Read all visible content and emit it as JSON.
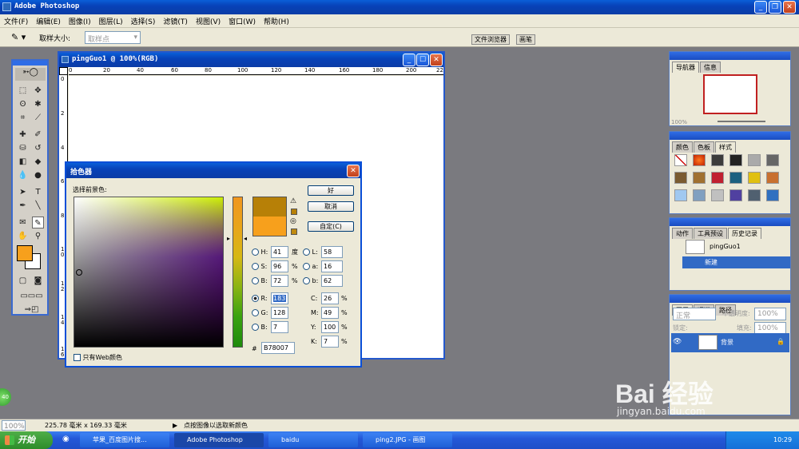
{
  "app": {
    "title": "Adobe Photoshop"
  },
  "menu": [
    "文件(F)",
    "编辑(E)",
    "图像(I)",
    "图层(L)",
    "选择(S)",
    "滤镜(T)",
    "视图(V)",
    "窗口(W)",
    "帮助(H)"
  ],
  "options": {
    "sample_size_label": "取样大小:",
    "sample_value": "取样点",
    "tab_file_browser": "文件浏览器",
    "tab_brushes": "画笔"
  },
  "doc": {
    "title": "pingGuo1 @ 100%(RGB)",
    "ruler": [
      "0",
      "20",
      "40",
      "60",
      "80",
      "100",
      "120",
      "140",
      "160",
      "180",
      "200",
      "22"
    ],
    "ruler_v": [
      "0",
      "2",
      "4",
      "6",
      "8",
      "1 0",
      "1 2",
      "1 4",
      "1 6"
    ]
  },
  "picker": {
    "title": "拾色器",
    "label": "选择前景色:",
    "ok": "好",
    "cancel": "取消",
    "custom": "自定(C)",
    "hsb": [
      {
        "k": "H:",
        "v": "41",
        "u": "度"
      },
      {
        "k": "S:",
        "v": "96",
        "u": "%"
      },
      {
        "k": "B:",
        "v": "72",
        "u": "%"
      }
    ],
    "rgb": [
      {
        "k": "R:",
        "v": "183"
      },
      {
        "k": "G:",
        "v": "128"
      },
      {
        "k": "B:",
        "v": "7"
      }
    ],
    "lab": [
      {
        "k": "L:",
        "v": "58"
      },
      {
        "k": "a:",
        "v": "16"
      },
      {
        "k": "b:",
        "v": "62"
      }
    ],
    "cmyk": [
      {
        "k": "C:",
        "v": "26",
        "u": "%"
      },
      {
        "k": "M:",
        "v": "49",
        "u": "%"
      },
      {
        "k": "Y:",
        "v": "100",
        "u": "%"
      },
      {
        "k": "K:",
        "v": "7",
        "u": "%"
      }
    ],
    "hex_label": "#",
    "hex": "B78007",
    "web_only": "只有Web颜色",
    "new_color": "#b78007",
    "old_color": "#f7a01c"
  },
  "navigator": {
    "tab1": "导航器",
    "tab2": "信息",
    "zoom": "100%"
  },
  "swatches": {
    "tabs": [
      "颜色",
      "色板",
      "样式"
    ]
  },
  "history": {
    "tabs": [
      "动作",
      "工具预设",
      "历史记录"
    ],
    "snapshot": "pingGuo1",
    "step": "新建"
  },
  "layers": {
    "tabs": [
      "图层",
      "通道",
      "路径"
    ],
    "mode": "正常",
    "opacity_label": "不透明度:",
    "opacity": "100%",
    "lock_label": "锁定:",
    "fill_label": "填充:",
    "fill": "100%",
    "layer_name": "背景"
  },
  "status": {
    "zoom": "100%",
    "size": "225.78 毫米 x 169.33 毫米",
    "hint": "点按图像以选取新颜色"
  },
  "taskbar": {
    "start": "开始",
    "items": [
      "苹果_百度图片搜...",
      "Adobe Photoshop",
      "baidu",
      "ping2.JPG - 画图"
    ],
    "time": "10:29",
    "badge": "40"
  },
  "watermark": {
    "brand": "Bai 经验",
    "url": "jingyan.baidu.com"
  }
}
